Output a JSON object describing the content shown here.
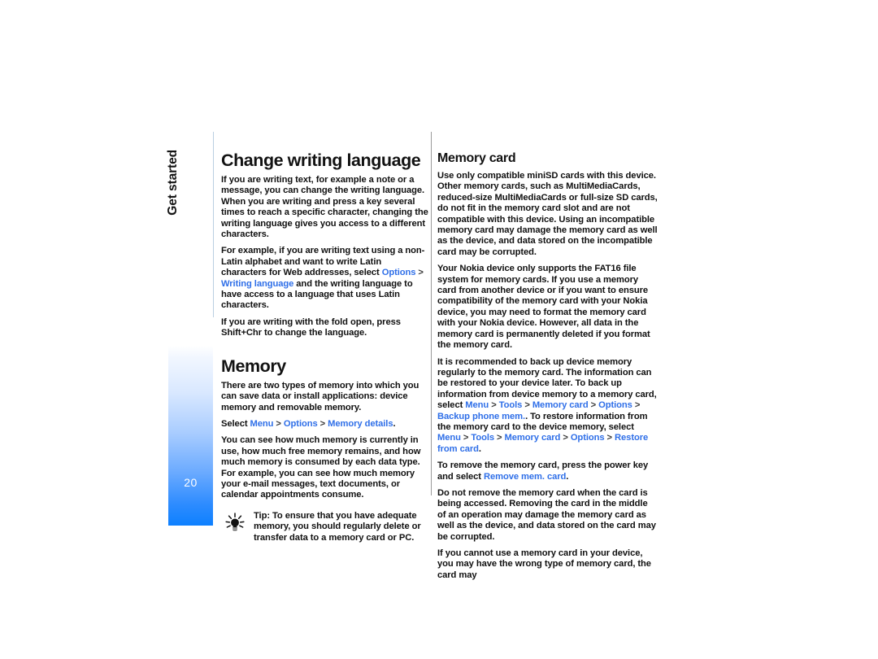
{
  "page": {
    "number": "20",
    "chapter": "Get started",
    "accent_color": "#2f6fe8",
    "strip_color": "#0d80ff"
  },
  "left_column": {
    "heading": "Change writing language",
    "paragraphs": [
      "If you are writing text, for example a note or a message, you can change the writing language. When you are writing and press a key several times to reach a specific character, changing the writing language gives you access to a different characters."
    ],
    "para_example": {
      "pre": "For example, if you are writing text using a non-Latin alphabet and want to write Latin characters for Web addresses, select ",
      "menu1": "Options",
      "sep1": " > ",
      "menu2": "Writing language",
      "post": " and the writing language to have access to a language that uses Latin characters."
    },
    "para_fold": "If you are writing with the fold open, press Shift+Chr to change the language.",
    "heading2": "Memory",
    "para_memory_intro": "There are two types of memory into which you can save data or install applications: device memory and removable memory.",
    "para_select": {
      "pre": "Select ",
      "menu1": "Menu",
      "sep1": " > ",
      "menu2": "Options",
      "sep2": " > ",
      "menu3": "Memory details",
      "post": "."
    },
    "para_usage": "You can see how much memory is currently in use, how much free memory remains, and how much memory is consumed by each data type. For example, you can see how much memory your e-mail messages, text documents, or calendar appointments consume.",
    "tip": {
      "label": "Tip:",
      "text": " To ensure that you have adequate memory, you should regularly delete or transfer data to a memory card or PC.",
      "icon": "lightbulb-icon"
    }
  },
  "right_column": {
    "heading": "Memory card",
    "para_compat": "Use only compatible miniSD cards with this device. Other memory cards, such as MultiMediaCards, reduced-size MultiMediaCards or full-size SD cards, do not fit in the memory card slot and are not compatible with this device. Using an incompatible memory card may damage the memory card as well as the device, and data stored on the incompatible card may be corrupted.",
    "para_fat16": "Your Nokia device only supports the FAT16 file system for memory cards. If you use a memory card from another device or if you want to ensure compatibility of the memory card with your Nokia device, you may need to format the memory card with your Nokia device. However, all data in the memory card is permanently deleted if you format the memory card.",
    "para_backup": {
      "pre": "It is recommended to back up device memory regularly to the memory card. The information can be restored to your device later. To back up information from device memory to a memory card, select ",
      "menu1": "Menu",
      "sep1": " > ",
      "menu2": "Tools",
      "sep2": " > ",
      "menu3": "Memory card",
      "sep3": " > ",
      "menu4": "Options",
      "sep4": " > ",
      "menu5": "Backup phone mem.",
      "mid": ". To restore information from the memory card to the device memory, select ",
      "menu6": "Menu",
      "sep5": " > ",
      "menu7": "Tools",
      "sep6": " > ",
      "menu8": "Memory card",
      "sep7": " > ",
      "menu9": "Options",
      "sep8": " > ",
      "menu10": "Restore from card",
      "post": "."
    },
    "para_remove": {
      "pre": "To remove the memory card, press the power key and select ",
      "menu1": "Remove mem. card",
      "post": "."
    },
    "para_warning": "Do not remove the memory card when the card is being accessed. Removing the card in the middle of an operation may damage the memory card as well as the device, and data stored on the card may be corrupted.",
    "para_cannot": "If you cannot use a memory card in your device, you may have the wrong type of memory card, the card may"
  }
}
